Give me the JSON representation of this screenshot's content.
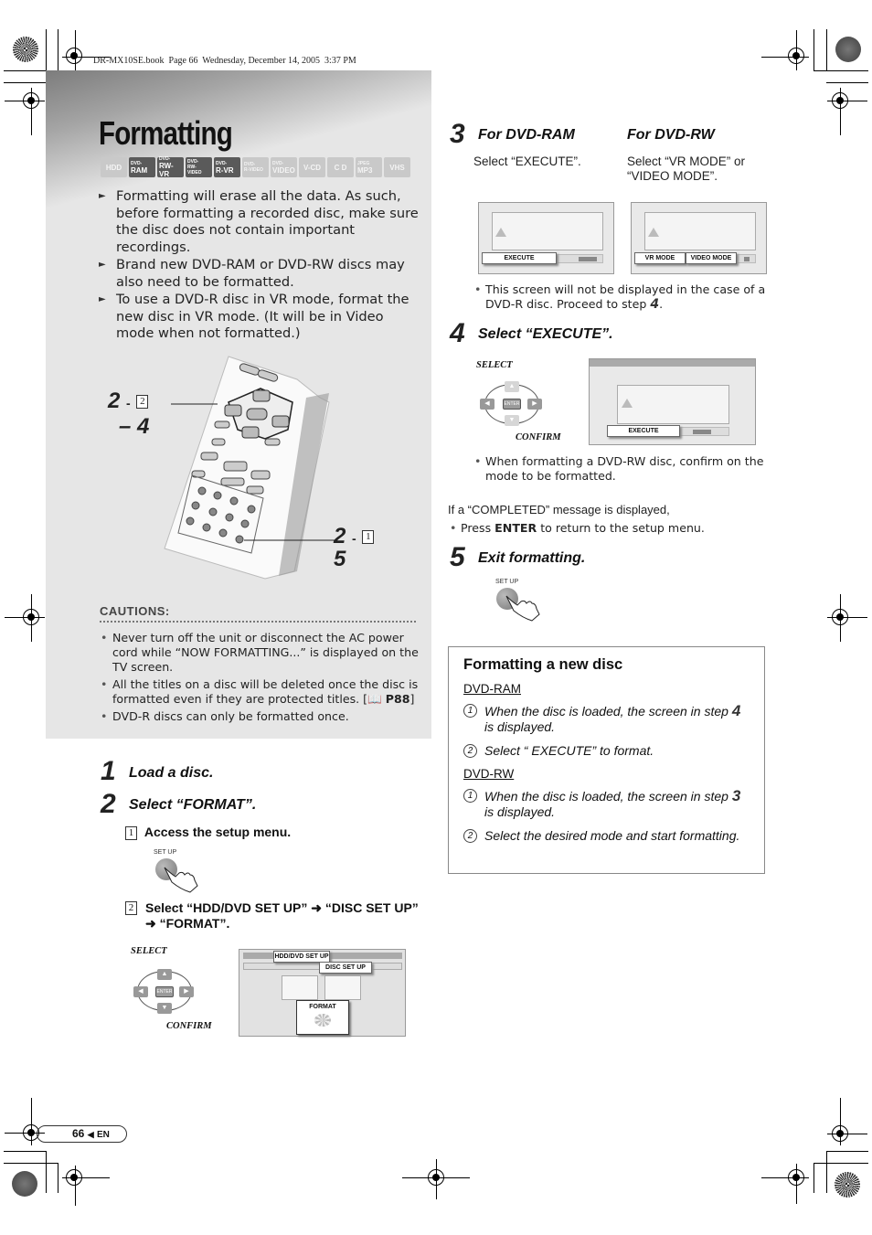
{
  "print_header": "DR-MX10SE.book  Page 66  Wednesday, December 14, 2005  3:37 PM",
  "title": "Formatting",
  "disc_badges": [
    {
      "top": "",
      "main": "HDD",
      "active": false
    },
    {
      "top": "DVD-",
      "main": "RAM",
      "active": true
    },
    {
      "top": "DVD-",
      "main": "RW-VR",
      "active": true
    },
    {
      "top": "DVD-",
      "main": "RW-VIDEO",
      "active": true
    },
    {
      "top": "DVD-",
      "main": "R-VR",
      "active": true
    },
    {
      "top": "DVD-",
      "main": "R-VIDEO",
      "active": false
    },
    {
      "top": "DVD-",
      "main": "VIDEO",
      "active": false
    },
    {
      "top": "",
      "main": "V-CD",
      "active": false
    },
    {
      "top": "",
      "main": "C D",
      "active": false
    },
    {
      "top": "JPEG",
      "main": "MP3",
      "active": false
    },
    {
      "top": "",
      "main": "VHS",
      "active": false
    }
  ],
  "intro_bullets": [
    "Formatting will erase all the data. As such, before formatting a recorded disc, make sure the disc does not contain important recordings.",
    "Brand new DVD-RAM or DVD-RW discs may also need to be formatted.",
    "To use a DVD-R disc in VR mode, format the new disc in VR mode. (It will be in Video mode when not formatted.)"
  ],
  "remote_callouts": {
    "upper_step": "2",
    "upper_sep": "-",
    "upper_box": "2",
    "upper_range": "– 4",
    "lower_step": "2",
    "lower_sep": "-",
    "lower_box": "1",
    "lower_extra": "5",
    "enter_key": "ENTER"
  },
  "cautions": {
    "title": "CAUTIONS:",
    "items": [
      "Never turn off the unit or disconnect the AC power cord while “NOW FORMATTING...” is displayed on the TV screen.",
      "All the titles on a disc will be deleted once the disc is formatted even if they are protected titles.",
      "DVD-R discs can only be formatted once."
    ],
    "ref": "P88"
  },
  "steps": {
    "s1": {
      "num": "1",
      "title": "Load a disc."
    },
    "s2": {
      "num": "2",
      "title": "Select “FORMAT”.",
      "sub1_num": "1",
      "sub1": "Access the setup menu.",
      "setup_label": "SET UP",
      "sub2_num": "2",
      "sub2": "Select “HDD/DVD SET UP” ➜ “DISC SET UP” ➜ “FORMAT”.",
      "select_label": "SELECT",
      "confirm_label": "CONFIRM",
      "enter_label": "ENTER",
      "menu_tab1": "HDD/DVD SET UP",
      "menu_tab2": "DISC SET UP",
      "menu_format": "FORMAT"
    },
    "s3": {
      "num": "3",
      "ram_title": "For DVD-RAM",
      "ram_text": "Select “EXECUTE”.",
      "rw_title": "For DVD-RW",
      "rw_text": "Select “VR MODE” or “VIDEO MODE”.",
      "execute_btn": "EXECUTE",
      "vr_btn": "VR MODE",
      "video_btn": "VIDEO MODE",
      "note": "This screen will not be displayed in the case of a DVD-R disc. Proceed to step",
      "note_step": "4"
    },
    "s4": {
      "num": "4",
      "title": "Select “EXECUTE”.",
      "select_label": "SELECT",
      "confirm_label": "CONFIRM",
      "enter_label": "ENTER",
      "execute_btn": "EXECUTE",
      "note": "When formatting a DVD-RW disc, confirm on the mode to be formatted."
    },
    "completed_text": "If a “COMPLETED” message is displayed,",
    "completed_bullet_pre": "Press",
    "completed_bullet_key": "ENTER",
    "completed_bullet_post": "to return to the setup menu.",
    "s5": {
      "num": "5",
      "title": "Exit formatting.",
      "setup_label": "SET UP"
    }
  },
  "infobox": {
    "title": "Formatting a new disc",
    "ram_heading": "DVD-RAM",
    "ram_items": [
      {
        "n": "1",
        "pre": "When the disc is loaded, the screen in step",
        "step": "4",
        "post": "is displayed."
      },
      {
        "n": "2",
        "text": "Select “ EXECUTE”  to format."
      }
    ],
    "rw_heading": "DVD-RW",
    "rw_items": [
      {
        "n": "1",
        "pre": "When the disc is loaded, the screen in step",
        "step": "3",
        "post": "is displayed."
      },
      {
        "n": "2",
        "text": "Select the desired mode and start formatting."
      }
    ]
  },
  "footer": {
    "page": "66",
    "arrow": "◀",
    "lang": "EN"
  }
}
